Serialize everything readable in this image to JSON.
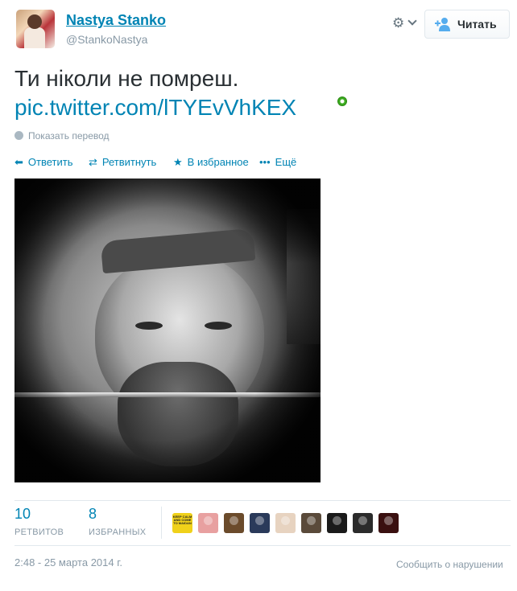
{
  "author": {
    "fullname": "Nastya Stanko",
    "handle": "@StankoNastya"
  },
  "follow_button": {
    "label": "Читать"
  },
  "tweet": {
    "text": "Ти ніколи не помреш.",
    "link": "pic.twitter.com/lTYEvVhKEX",
    "translate_label": "Показать перевод"
  },
  "actions": {
    "reply": "Ответить",
    "retweet": "Ретвитнуть",
    "favorite": "В избранное",
    "more": "Ещё"
  },
  "stats": {
    "retweets_count": "10",
    "retweets_label": "РЕТВИТОВ",
    "favorites_count": "8",
    "favorites_label": "ИЗБРАННЫХ"
  },
  "favoriters": [
    {
      "name": "keep-calm-avatar",
      "color": "#f0d11a",
      "text": "KEEP CALM AND COME TO MAIDAN"
    },
    {
      "name": "avatar-2",
      "color": "#e8a0a0"
    },
    {
      "name": "avatar-3",
      "color": "#6b4b2b"
    },
    {
      "name": "avatar-4",
      "color": "#2a3a5a"
    },
    {
      "name": "avatar-5",
      "color": "#e7d3c0"
    },
    {
      "name": "avatar-6",
      "color": "#5a4a3a"
    },
    {
      "name": "avatar-7",
      "color": "#1a1a1a"
    },
    {
      "name": "avatar-8",
      "color": "#2b2b2b"
    },
    {
      "name": "avatar-9",
      "color": "#3a1010"
    }
  ],
  "footer": {
    "date": "2:48 - 25 марта 2014 г.",
    "report": "Сообщить о нарушении"
  },
  "colors": {
    "link": "#0084b4",
    "muted": "#8899a6",
    "text": "#292f33"
  }
}
